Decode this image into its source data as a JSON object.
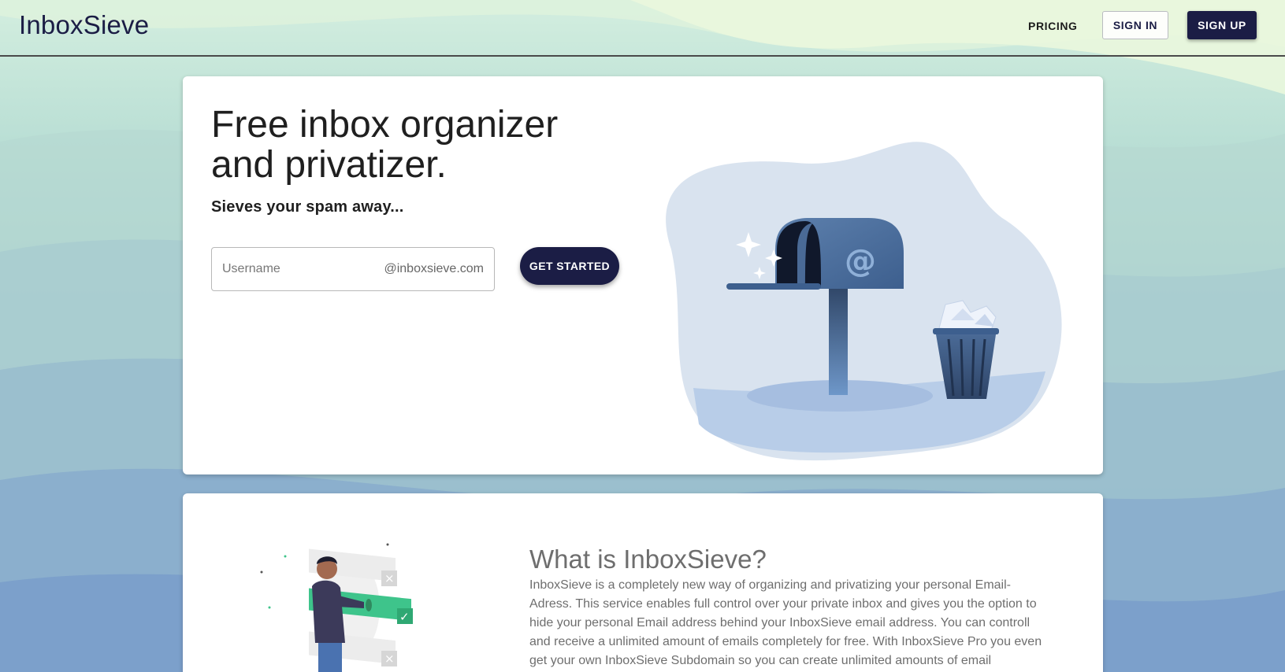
{
  "header": {
    "logo": "InboxSieve",
    "nav": {
      "pricing": "PRICING",
      "sign_in": "SIGN IN",
      "sign_up": "SIGN UP"
    }
  },
  "hero": {
    "title": "Free inbox organizer and privatizer.",
    "subtitle": "Sieves your spam away...",
    "username_field": {
      "placeholder": "Username",
      "value": "",
      "suffix": "@inboxsieve.com"
    },
    "cta_label": "GET STARTED",
    "illustration_glyph": "@"
  },
  "about": {
    "title": "What is InboxSieve?",
    "text": "InboxSieve is a completely new way of organizing and privatizing your personal Email-Adress. This service enables full control over your private inbox and gives you the option to hide your personal Email address behind your InboxSieve email address. You can controll and receive a unlimited amount of emails completely for free. With InboxSieve Pro you even get your own InboxSieve Subdomain so you can create unlimited amounts of email"
  },
  "colors": {
    "brand_navy": "#1b1d45",
    "card": "#ffffff",
    "text_dark": "#1f1f1f",
    "text_muted": "#6e6e6e",
    "blob": "#d9e3ef",
    "mailbox_blue": "#5c7fab",
    "accent_green": "#3ec48b"
  },
  "icons": [
    "mailbox-illustration",
    "trash-bin-illustration",
    "sparkle-icon",
    "person-checklist-illustration",
    "check-icon",
    "x-icon"
  ]
}
